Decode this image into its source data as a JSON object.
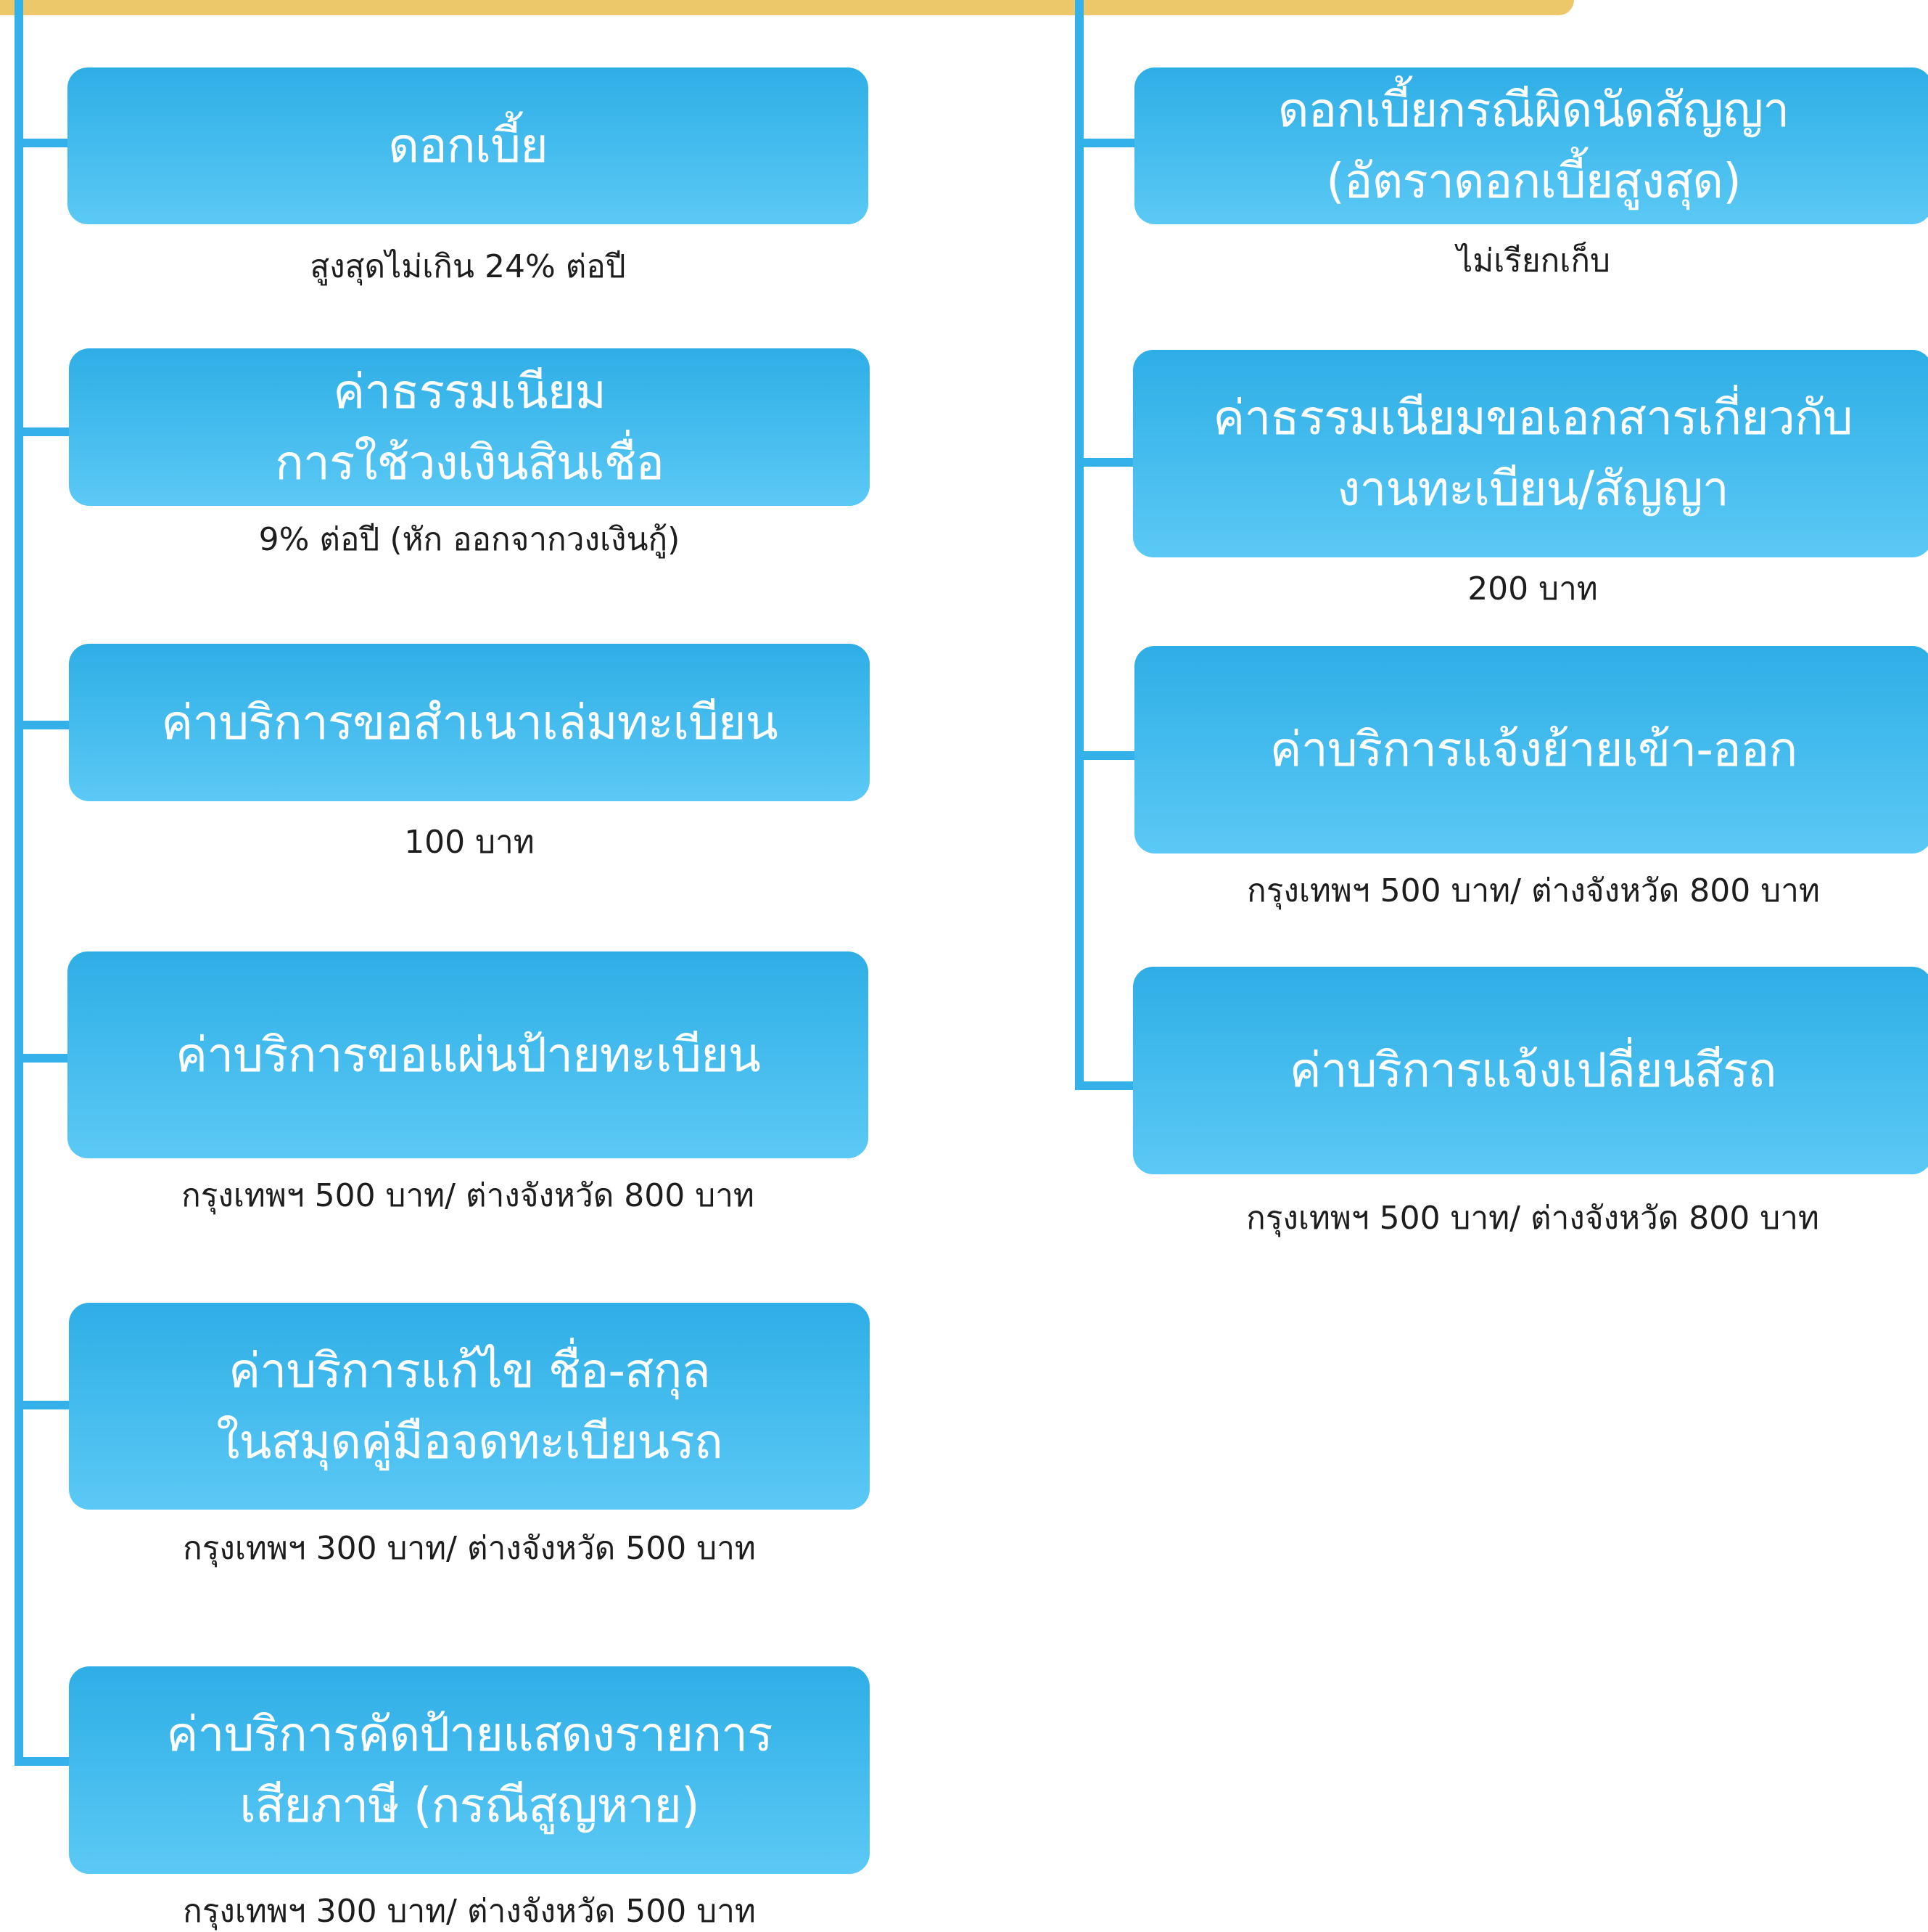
{
  "colors": {
    "header_bar": "#ecc86a",
    "connector": "#33b1e8",
    "card_top": "#2eaee6",
    "card_bottom": "#5bc9f5",
    "card_text": "#ffffff",
    "note_text": "#1d1d1d"
  },
  "left_column": {
    "items": [
      {
        "title_lines": [
          "ดอกเบี้ย"
        ],
        "note": "สูงสุดไม่เกิน 24% ต่อปี"
      },
      {
        "title_lines": [
          "ค่าธรรมเนียม",
          "การใช้วงเงินสินเชื่อ"
        ],
        "note": "9% ต่อปี (หัก ออกจากวงเงินกู้)"
      },
      {
        "title_lines": [
          "ค่าบริการขอสำเนาเล่มทะเบียน"
        ],
        "note": "100 บาท"
      },
      {
        "title_lines": [
          "ค่าบริการขอแผ่นป้ายทะเบียน"
        ],
        "note": "กรุงเทพฯ 500 บาท/ ต่างจังหวัด 800 บาท"
      },
      {
        "title_lines": [
          "ค่าบริการแก้ไข ชื่อ-สกุล",
          "ในสมุดคู่มือจดทะเบียนรถ"
        ],
        "note": "กรุงเทพฯ 300 บาท/ ต่างจังหวัด 500 บาท"
      },
      {
        "title_lines": [
          "ค่าบริการคัดป้ายแสดงรายการ",
          "เสียภาษี (กรณีสูญหาย)"
        ],
        "note": "กรุงเทพฯ 300 บาท/ ต่างจังหวัด 500 บาท"
      }
    ]
  },
  "right_column": {
    "items": [
      {
        "title_lines": [
          "ดอกเบี้ยกรณีผิดนัดสัญญา",
          "(อัตราดอกเบี้ยสูงสุด)"
        ],
        "note": "ไม่เรียกเก็บ"
      },
      {
        "title_lines": [
          "ค่าธรรมเนียมขอเอกสารเกี่ยวกับ",
          "งานทะเบียน/สัญญา"
        ],
        "note": "200 บาท"
      },
      {
        "title_lines": [
          "ค่าบริการแจ้งย้ายเข้า-ออก"
        ],
        "note": "กรุงเทพฯ 500 บาท/ ต่างจังหวัด 800 บาท"
      },
      {
        "title_lines": [
          "ค่าบริการแจ้งเปลี่ยนสีรถ"
        ],
        "note": "กรุงเทพฯ 500 บาท/ ต่างจังหวัด 800 บาท"
      }
    ]
  }
}
